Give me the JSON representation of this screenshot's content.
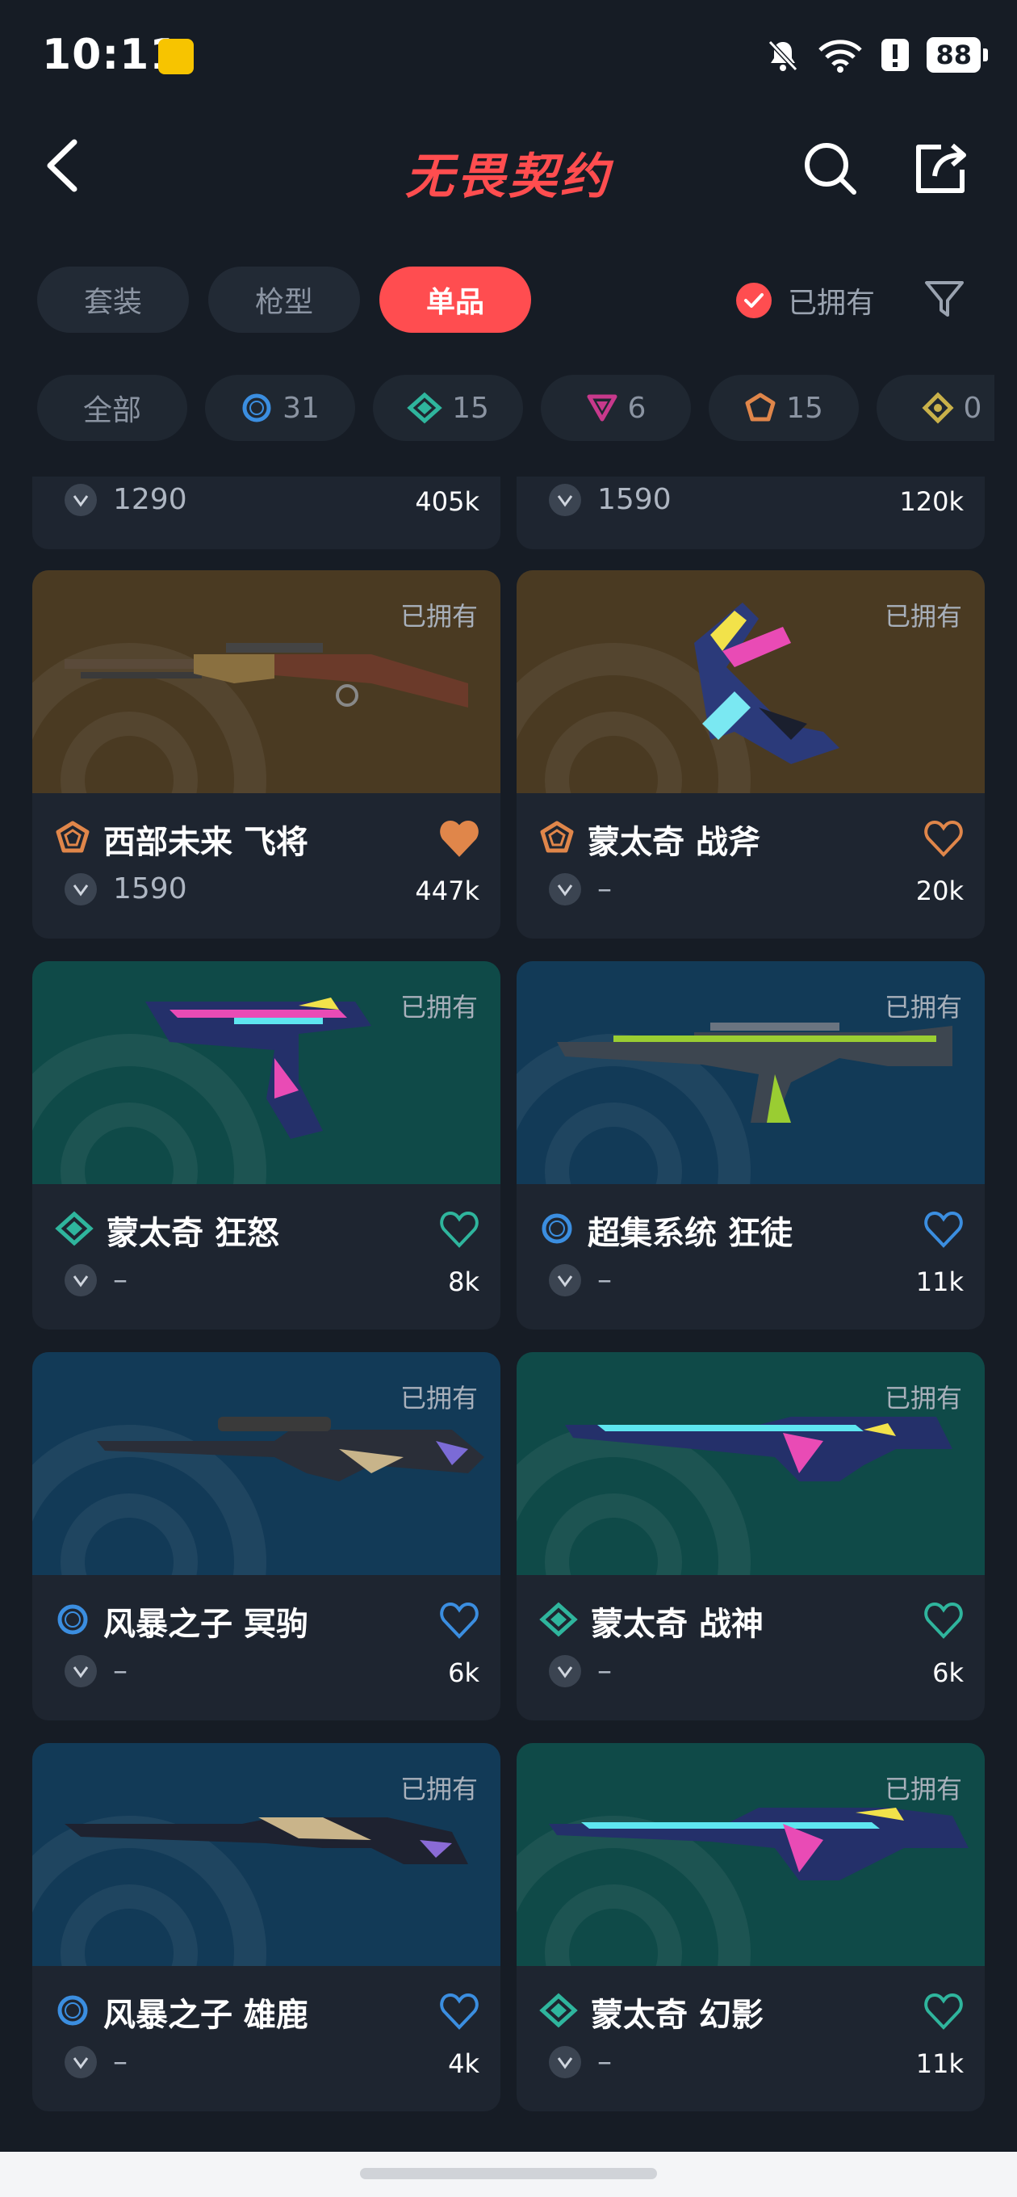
{
  "status_bar": {
    "time": "10:11",
    "battery": "88"
  },
  "header": {
    "title": "无畏契约"
  },
  "tabs": [
    {
      "label": "套装",
      "active": false
    },
    {
      "label": "枪型",
      "active": false
    },
    {
      "label": "单品",
      "active": true
    }
  ],
  "owned_filter": {
    "label": "已拥有",
    "checked": true
  },
  "rarity_chips": [
    {
      "label": "全部",
      "count": "",
      "icon": "all",
      "color": ""
    },
    {
      "label": "",
      "count": "31",
      "icon": "select-edition-icon",
      "color": "#3b8ee0"
    },
    {
      "label": "",
      "count": "15",
      "icon": "deluxe-edition-icon",
      "color": "#2fb59d"
    },
    {
      "label": "",
      "count": "6",
      "icon": "premium-edition-icon",
      "color": "#c8398c"
    },
    {
      "label": "",
      "count": "15",
      "icon": "exclusive-edition-icon",
      "color": "#e0864a"
    },
    {
      "label": "",
      "count": "0",
      "icon": "ultra-edition-icon",
      "color": "#c9b14a"
    }
  ],
  "top_partial_cards": [
    {
      "price": "1290",
      "likes": "405k"
    },
    {
      "price": "1590",
      "likes": "120k"
    }
  ],
  "cards": [
    {
      "name": "西部未来 飞将",
      "price": "1590",
      "likes": "447k",
      "owned": "已拥有",
      "tier": "exclusive",
      "tier_color": "#e0864a",
      "bg": "#4a3a22",
      "heart_filled": true,
      "weapon": "rifle-lever"
    },
    {
      "name": "蒙太奇 战斧",
      "price": "–",
      "likes": "20k",
      "owned": "已拥有",
      "tier": "exclusive",
      "tier_color": "#e0864a",
      "bg": "#4a3a22",
      "heart_filled": false,
      "weapon": "axe"
    },
    {
      "name": "蒙太奇 狂怒",
      "price": "–",
      "likes": "8k",
      "owned": "已拥有",
      "tier": "deluxe",
      "tier_color": "#2fb59d",
      "bg": "#0f4a48",
      "heart_filled": false,
      "weapon": "pistol"
    },
    {
      "name": "超集系统 狂徒",
      "price": "–",
      "likes": "11k",
      "owned": "已拥有",
      "tier": "select",
      "tier_color": "#3b8ee0",
      "bg": "#123a57",
      "heart_filled": false,
      "weapon": "ak"
    },
    {
      "name": "风暴之子 冥驹",
      "price": "–",
      "likes": "6k",
      "owned": "已拥有",
      "tier": "select",
      "tier_color": "#3b8ee0",
      "bg": "#123a57",
      "heart_filled": false,
      "weapon": "sniper"
    },
    {
      "name": "蒙太奇 战神",
      "price": "–",
      "likes": "6k",
      "owned": "已拥有",
      "tier": "deluxe",
      "tier_color": "#2fb59d",
      "bg": "#0f4a48",
      "heart_filled": false,
      "weapon": "smg"
    },
    {
      "name": "风暴之子 雄鹿",
      "price": "–",
      "likes": "4k",
      "owned": "已拥有",
      "tier": "select",
      "tier_color": "#3b8ee0",
      "bg": "#123a57",
      "heart_filled": false,
      "weapon": "shotgun"
    },
    {
      "name": "蒙太奇 幻影",
      "price": "–",
      "likes": "11k",
      "owned": "已拥有",
      "tier": "deluxe",
      "tier_color": "#2fb59d",
      "bg": "#0f4a48",
      "heart_filled": false,
      "weapon": "rifle"
    }
  ]
}
